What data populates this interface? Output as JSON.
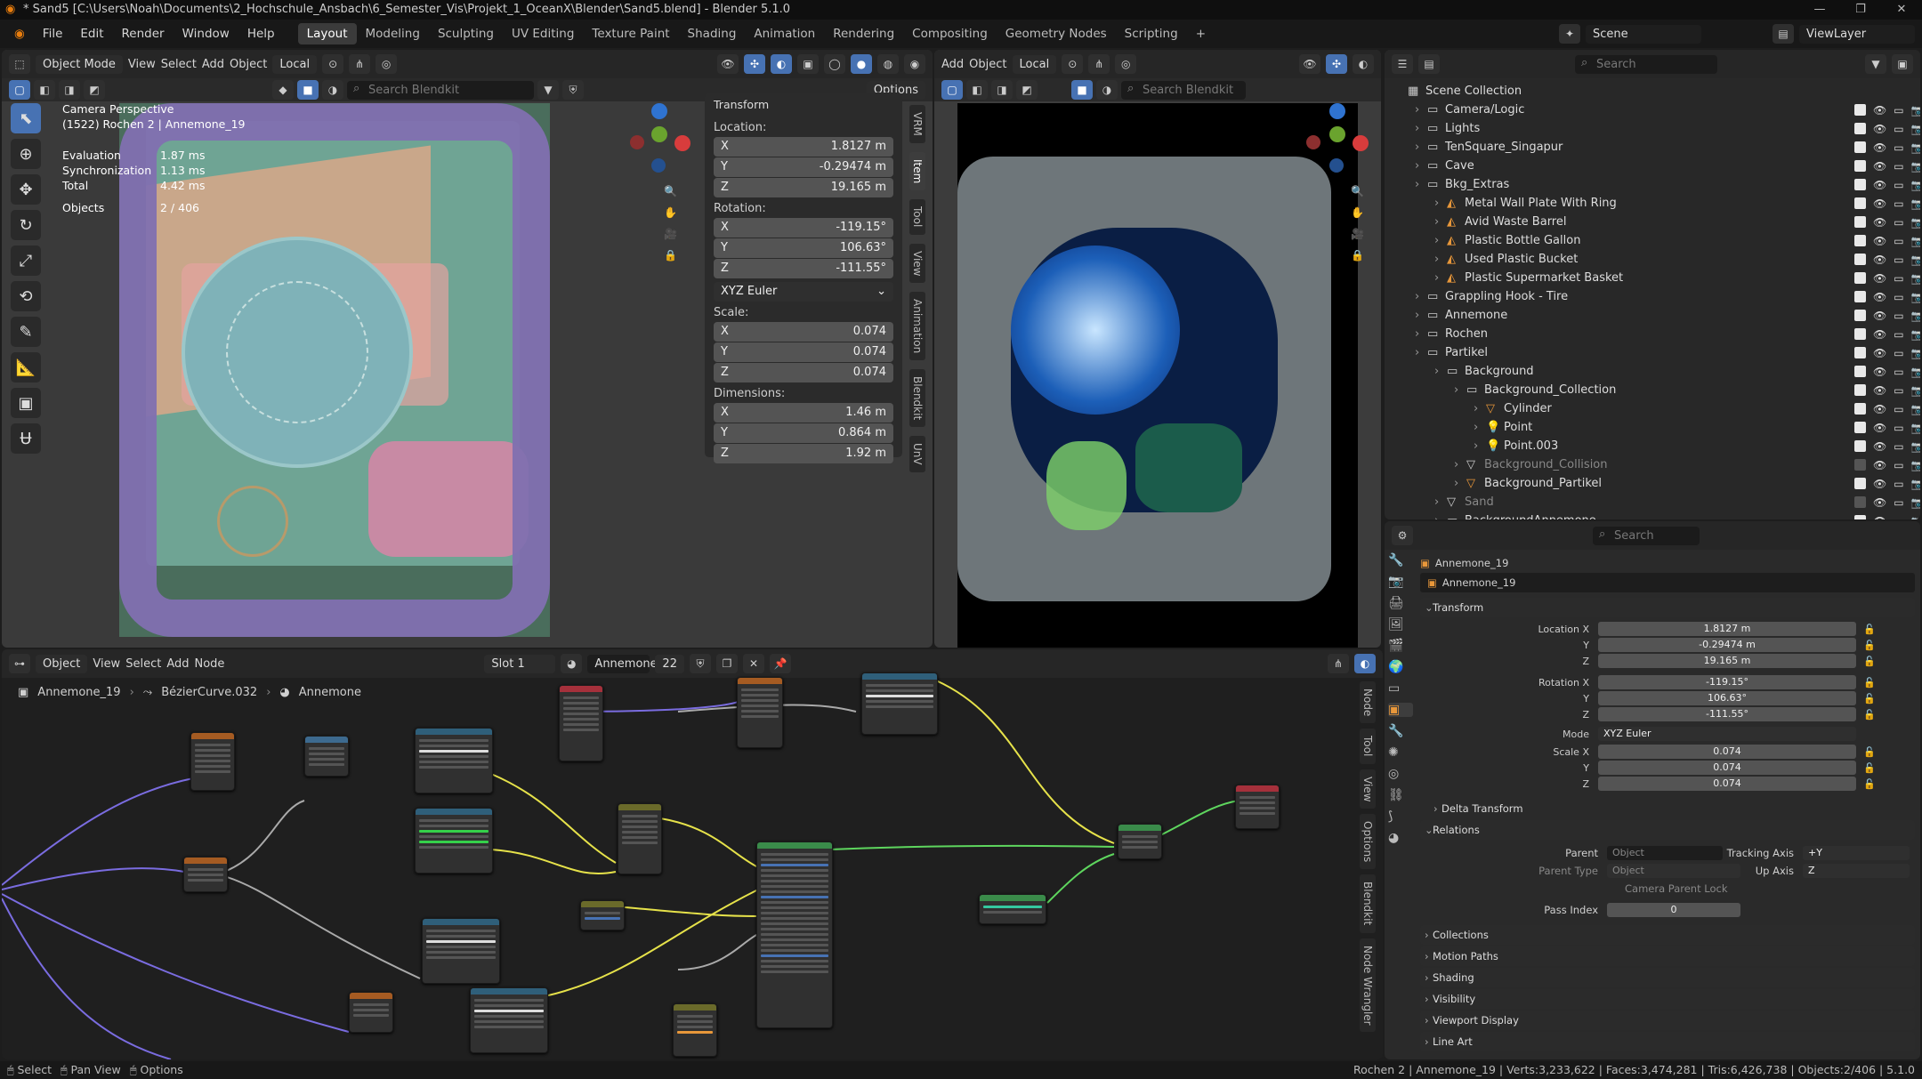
{
  "window": {
    "title": "* Sand5 [C:\\Users\\Noah\\Documents\\2_Hochschule_Ansbach\\6_Semester_Vis\\Projekt_1_OceanX\\Blender\\Sand5.blend] - Blender 5.1.0",
    "controls": [
      "—",
      "❐",
      "✕"
    ]
  },
  "menu": {
    "items": [
      "File",
      "Edit",
      "Render",
      "Window",
      "Help"
    ],
    "workspaces": [
      "Layout",
      "Modeling",
      "Sculpting",
      "UV Editing",
      "Texture Paint",
      "Shading",
      "Animation",
      "Rendering",
      "Compositing",
      "Geometry Nodes",
      "Scripting",
      "+"
    ],
    "active_workspace": "Layout",
    "scene": "Scene",
    "view_layer": "ViewLayer"
  },
  "viewport_left": {
    "mode": "Object Mode",
    "menus": [
      "View",
      "Select",
      "Add",
      "Object"
    ],
    "orientation": "Local",
    "search_placeholder": "Search Blendkit",
    "options": "Options",
    "overlay_lines": [
      "Camera Perspective",
      "(1522) Rochen 2 | Annemone_19"
    ],
    "stats": [
      {
        "k": "Evaluation",
        "v": "1.87 ms"
      },
      {
        "k": "Synchronization",
        "v": "1.13 ms"
      },
      {
        "k": "Total",
        "v": "4.42 ms"
      },
      {
        "k": "Objects",
        "v": "2 / 406"
      }
    ],
    "npanel": {
      "title": "Transform",
      "location_label": "Location:",
      "location": [
        {
          "axis": "X",
          "val": "1.8127 m"
        },
        {
          "axis": "Y",
          "val": "-0.29474 m"
        },
        {
          "axis": "Z",
          "val": "19.165 m"
        }
      ],
      "rotation_label": "Rotation:",
      "rotation": [
        {
          "axis": "X",
          "val": "-119.15°"
        },
        {
          "axis": "Y",
          "val": "106.63°"
        },
        {
          "axis": "Z",
          "val": "-111.55°"
        }
      ],
      "rot_mode": "XYZ Euler",
      "scale_label": "Scale:",
      "scale": [
        {
          "axis": "X",
          "val": "0.074"
        },
        {
          "axis": "Y",
          "val": "0.074"
        },
        {
          "axis": "Z",
          "val": "0.074"
        }
      ],
      "dim_label": "Dimensions:",
      "dims": [
        {
          "axis": "X",
          "val": "1.46 m"
        },
        {
          "axis": "Y",
          "val": "0.864 m"
        },
        {
          "axis": "Z",
          "val": "1.92 m"
        }
      ],
      "tabs": [
        "VRM",
        "Item",
        "Tool",
        "View",
        "Animation",
        "Blendkit",
        "UnV"
      ],
      "active_tab": "Item"
    }
  },
  "viewport_right": {
    "menus": [
      "Add",
      "Object"
    ],
    "orientation": "Local",
    "search_placeholder": "Search Blendkit"
  },
  "outliner": {
    "search_placeholder": "Search",
    "rows": [
      {
        "name": "Scene Collection",
        "depth": 0,
        "type": "scene"
      },
      {
        "name": "Camera/Logic",
        "depth": 1,
        "type": "coll"
      },
      {
        "name": "Lights",
        "depth": 1,
        "type": "coll"
      },
      {
        "name": "TenSquare_Singapur",
        "depth": 1,
        "type": "coll"
      },
      {
        "name": "Cave",
        "depth": 1,
        "type": "coll"
      },
      {
        "name": "Bkg_Extras",
        "depth": 1,
        "type": "coll"
      },
      {
        "name": "Metal Wall Plate With Ring",
        "depth": 2,
        "type": "obj"
      },
      {
        "name": "Avid Waste Barrel",
        "depth": 2,
        "type": "obj"
      },
      {
        "name": "Plastic Bottle Gallon",
        "depth": 2,
        "type": "obj"
      },
      {
        "name": "Used Plastic Bucket",
        "depth": 2,
        "type": "obj"
      },
      {
        "name": "Plastic Supermarket Basket",
        "depth": 2,
        "type": "obj"
      },
      {
        "name": "Grappling Hook - Tire",
        "depth": 1,
        "type": "coll"
      },
      {
        "name": "Annemone",
        "depth": 1,
        "type": "coll"
      },
      {
        "name": "Rochen",
        "depth": 1,
        "type": "coll"
      },
      {
        "name": "Partikel",
        "depth": 1,
        "type": "coll"
      },
      {
        "name": "Background",
        "depth": 2,
        "type": "coll"
      },
      {
        "name": "Background_Collection",
        "depth": 3,
        "type": "coll"
      },
      {
        "name": "Cylinder",
        "depth": 4,
        "type": "mesh"
      },
      {
        "name": "Point",
        "depth": 4,
        "type": "light"
      },
      {
        "name": "Point.003",
        "depth": 4,
        "type": "light"
      },
      {
        "name": "Background_Collision",
        "depth": 3,
        "type": "dim"
      },
      {
        "name": "Background_Partikel",
        "depth": 3,
        "type": "mesh"
      },
      {
        "name": "Sand",
        "depth": 2,
        "type": "dim"
      },
      {
        "name": "BackgroundAnnemone",
        "depth": 2,
        "type": "coll"
      }
    ]
  },
  "properties": {
    "search_placeholder": "Search",
    "object": "Annemone_19",
    "name_field": "Annemone_19",
    "transform": "Transform",
    "loc": [
      {
        "l": "Location X",
        "v": "1.8127 m"
      },
      {
        "l": "Y",
        "v": "-0.29474 m"
      },
      {
        "l": "Z",
        "v": "19.165 m"
      }
    ],
    "rot": [
      {
        "l": "Rotation X",
        "v": "-119.15°"
      },
      {
        "l": "Y",
        "v": "106.63°"
      },
      {
        "l": "Z",
        "v": "-111.55°"
      }
    ],
    "mode_label": "Mode",
    "mode": "XYZ Euler",
    "scale": [
      {
        "l": "Scale X",
        "v": "0.074"
      },
      {
        "l": "Y",
        "v": "0.074"
      },
      {
        "l": "Z",
        "v": "0.074"
      }
    ],
    "delta": "Delta Transform",
    "relations": "Relations",
    "parent_label": "Parent",
    "parent_ph": "Object",
    "parent_type_label": "Parent Type",
    "parent_type": "Object",
    "tracking_label": "Tracking Axis",
    "tracking": "+Y",
    "up_label": "Up Axis",
    "up": "Z",
    "cam_lock": "Camera Parent Lock",
    "pass_label": "Pass Index",
    "pass": "0",
    "collapsed": [
      "Collections",
      "Motion Paths",
      "Shading",
      "Visibility",
      "Viewport Display",
      "Line Art"
    ]
  },
  "nodes": {
    "type": "Object",
    "menus": [
      "View",
      "Select",
      "Add",
      "Node"
    ],
    "slot": "Slot 1",
    "material": "Annemone",
    "users": "22",
    "breadcrumb": [
      "Annemone_19",
      "BézierCurve.032",
      "Annemone"
    ],
    "tabs": [
      "Node",
      "Tool",
      "View",
      "Options",
      "Blendkit",
      "Node Wrangler"
    ]
  },
  "status": {
    "left": [
      "Select",
      "Pan View",
      "Options"
    ],
    "right": "Rochen 2 | Annemone_19 | Verts:3,233,622 | Faces:3,474,281 | Tris:6,426,738 | Objects:2/406 | 5.1.0"
  }
}
